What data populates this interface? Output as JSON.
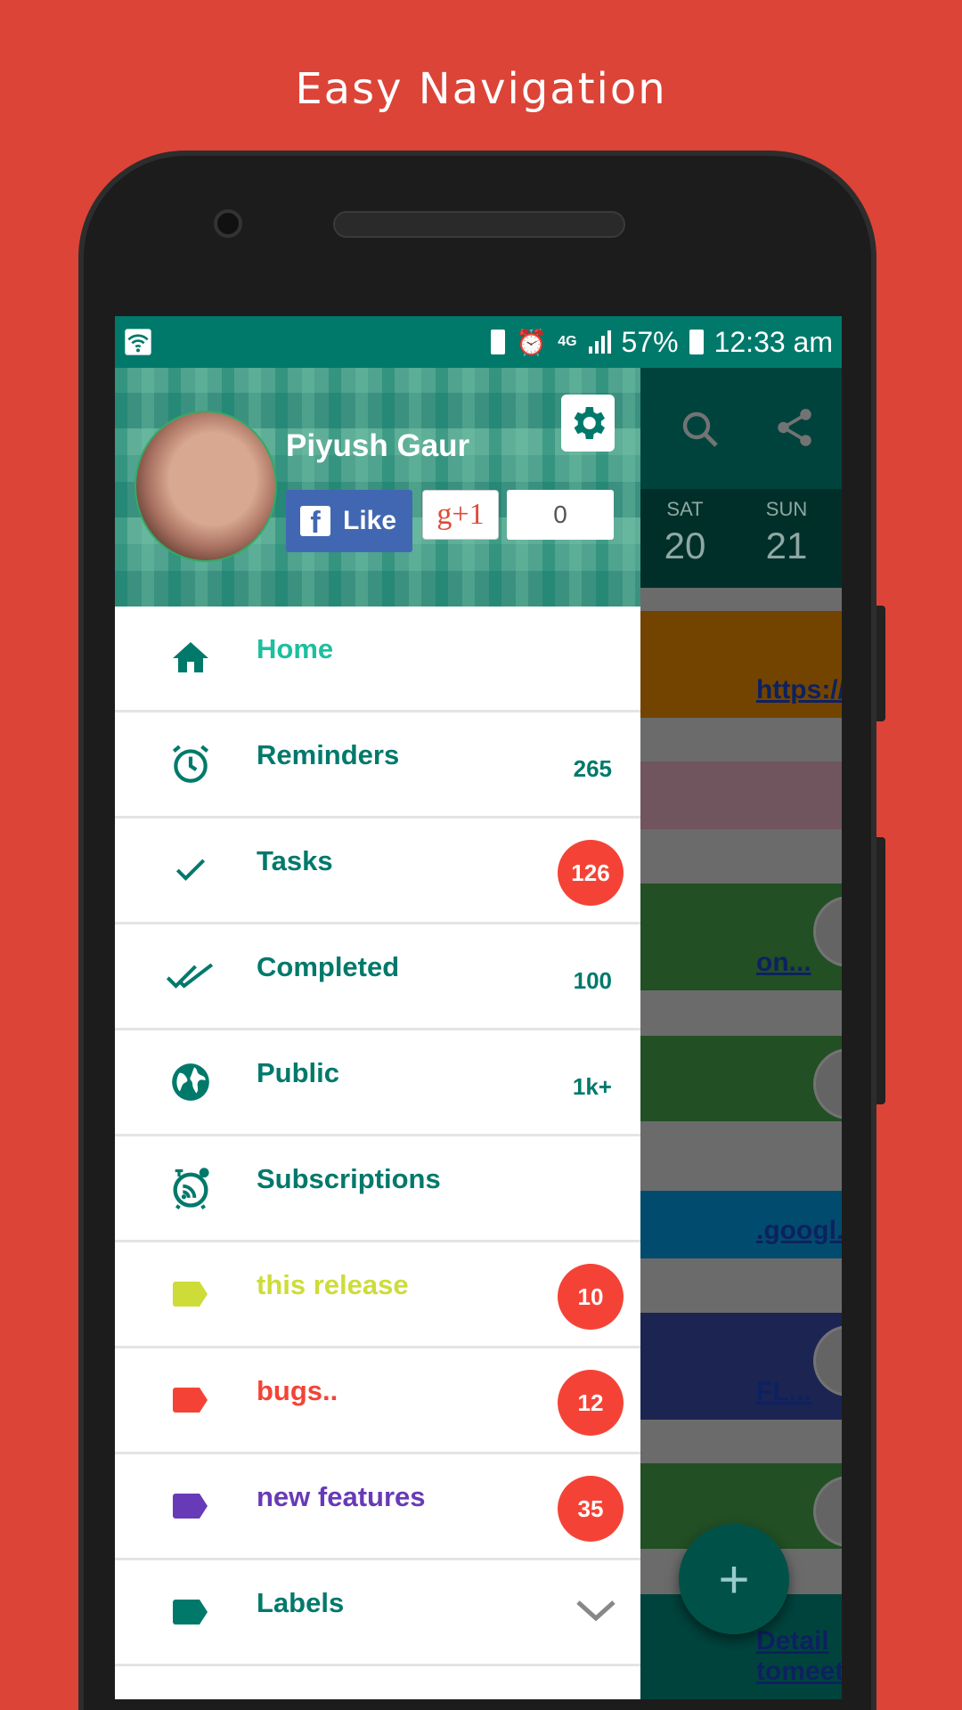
{
  "headline": "Easy Navigation",
  "status": {
    "battery": "57%",
    "time": "12:33 am",
    "network": "4G"
  },
  "header": {
    "user_name": "Piyush Gaur",
    "fb_like": "Like",
    "gplus": "g+1",
    "gplus_count": "0"
  },
  "toolbar": {
    "days": [
      {
        "day": "SAT",
        "date": "20"
      },
      {
        "day": "SUN",
        "date": "21"
      }
    ]
  },
  "cards": [
    {
      "color": "#ff9800",
      "text": "https://..."
    },
    {
      "color": "#f8bbd0",
      "text": ""
    },
    {
      "color": "#4caf50",
      "text": "on..."
    },
    {
      "color": "#4caf50",
      "text": ""
    },
    {
      "color": "#03a9f4",
      "text": ".googl..."
    },
    {
      "color": "#3f51b5",
      "text": "FL..."
    },
    {
      "color": "#4caf50",
      "text": ""
    },
    {
      "color": "#009688",
      "text": "Detail tomeeti..."
    }
  ],
  "menu": [
    {
      "label": "Home",
      "icon": "home-icon",
      "color": "#1dbf9f",
      "count": ""
    },
    {
      "label": "Reminders",
      "icon": "alarm-icon",
      "color": "#00796b",
      "count": "265"
    },
    {
      "label": "Tasks",
      "icon": "check-icon",
      "color": "#00796b",
      "badge": "126"
    },
    {
      "label": "Completed",
      "icon": "double-check-icon",
      "color": "#00796b",
      "count": "100"
    },
    {
      "label": "Public",
      "icon": "globe-icon",
      "color": "#00796b",
      "count": "1k+"
    },
    {
      "label": "Subscriptions",
      "icon": "rss-alarm-icon",
      "color": "#00796b",
      "count": ""
    },
    {
      "label": "this release",
      "icon": "label-icon",
      "color": "#cddc39",
      "badge": "10"
    },
    {
      "label": "bugs..",
      "icon": "label-icon",
      "color": "#f44336",
      "badge": "12"
    },
    {
      "label": "new features",
      "icon": "label-icon",
      "color": "#673ab7",
      "badge": "35"
    },
    {
      "label": "Labels",
      "icon": "label-icon",
      "color": "#00796b",
      "count": ""
    }
  ],
  "colors": {
    "background": "#dc4437",
    "primary": "#00796b",
    "badge": "#f44336"
  }
}
